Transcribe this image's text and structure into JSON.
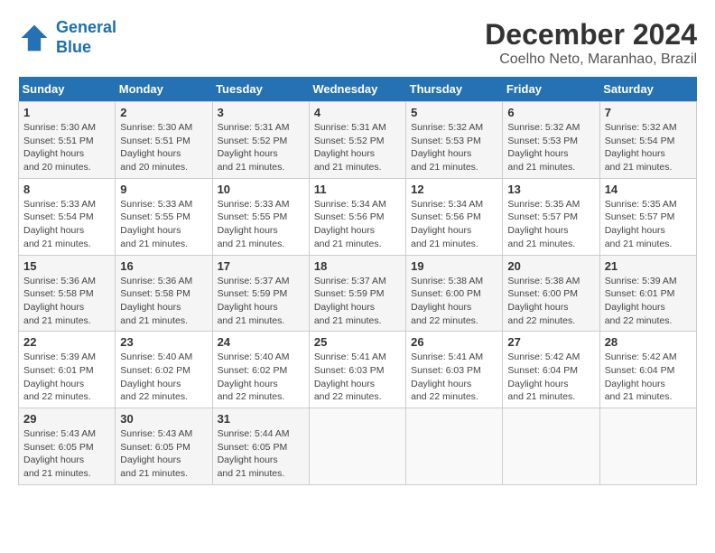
{
  "header": {
    "logo_line1": "General",
    "logo_line2": "Blue",
    "month_title": "December 2024",
    "subtitle": "Coelho Neto, Maranhao, Brazil"
  },
  "weekdays": [
    "Sunday",
    "Monday",
    "Tuesday",
    "Wednesday",
    "Thursday",
    "Friday",
    "Saturday"
  ],
  "weeks": [
    [
      {
        "day": "1",
        "sunrise": "5:30 AM",
        "sunset": "5:51 PM",
        "daylight": "12 hours and 20 minutes."
      },
      {
        "day": "2",
        "sunrise": "5:30 AM",
        "sunset": "5:51 PM",
        "daylight": "12 hours and 20 minutes."
      },
      {
        "day": "3",
        "sunrise": "5:31 AM",
        "sunset": "5:52 PM",
        "daylight": "12 hours and 21 minutes."
      },
      {
        "day": "4",
        "sunrise": "5:31 AM",
        "sunset": "5:52 PM",
        "daylight": "12 hours and 21 minutes."
      },
      {
        "day": "5",
        "sunrise": "5:32 AM",
        "sunset": "5:53 PM",
        "daylight": "12 hours and 21 minutes."
      },
      {
        "day": "6",
        "sunrise": "5:32 AM",
        "sunset": "5:53 PM",
        "daylight": "12 hours and 21 minutes."
      },
      {
        "day": "7",
        "sunrise": "5:32 AM",
        "sunset": "5:54 PM",
        "daylight": "12 hours and 21 minutes."
      }
    ],
    [
      {
        "day": "8",
        "sunrise": "5:33 AM",
        "sunset": "5:54 PM",
        "daylight": "12 hours and 21 minutes."
      },
      {
        "day": "9",
        "sunrise": "5:33 AM",
        "sunset": "5:55 PM",
        "daylight": "12 hours and 21 minutes."
      },
      {
        "day": "10",
        "sunrise": "5:33 AM",
        "sunset": "5:55 PM",
        "daylight": "12 hours and 21 minutes."
      },
      {
        "day": "11",
        "sunrise": "5:34 AM",
        "sunset": "5:56 PM",
        "daylight": "12 hours and 21 minutes."
      },
      {
        "day": "12",
        "sunrise": "5:34 AM",
        "sunset": "5:56 PM",
        "daylight": "12 hours and 21 minutes."
      },
      {
        "day": "13",
        "sunrise": "5:35 AM",
        "sunset": "5:57 PM",
        "daylight": "12 hours and 21 minutes."
      },
      {
        "day": "14",
        "sunrise": "5:35 AM",
        "sunset": "5:57 PM",
        "daylight": "12 hours and 21 minutes."
      }
    ],
    [
      {
        "day": "15",
        "sunrise": "5:36 AM",
        "sunset": "5:58 PM",
        "daylight": "12 hours and 21 minutes."
      },
      {
        "day": "16",
        "sunrise": "5:36 AM",
        "sunset": "5:58 PM",
        "daylight": "12 hours and 21 minutes."
      },
      {
        "day": "17",
        "sunrise": "5:37 AM",
        "sunset": "5:59 PM",
        "daylight": "12 hours and 21 minutes."
      },
      {
        "day": "18",
        "sunrise": "5:37 AM",
        "sunset": "5:59 PM",
        "daylight": "12 hours and 21 minutes."
      },
      {
        "day": "19",
        "sunrise": "5:38 AM",
        "sunset": "6:00 PM",
        "daylight": "12 hours and 22 minutes."
      },
      {
        "day": "20",
        "sunrise": "5:38 AM",
        "sunset": "6:00 PM",
        "daylight": "12 hours and 22 minutes."
      },
      {
        "day": "21",
        "sunrise": "5:39 AM",
        "sunset": "6:01 PM",
        "daylight": "12 hours and 22 minutes."
      }
    ],
    [
      {
        "day": "22",
        "sunrise": "5:39 AM",
        "sunset": "6:01 PM",
        "daylight": "12 hours and 22 minutes."
      },
      {
        "day": "23",
        "sunrise": "5:40 AM",
        "sunset": "6:02 PM",
        "daylight": "12 hours and 22 minutes."
      },
      {
        "day": "24",
        "sunrise": "5:40 AM",
        "sunset": "6:02 PM",
        "daylight": "12 hours and 22 minutes."
      },
      {
        "day": "25",
        "sunrise": "5:41 AM",
        "sunset": "6:03 PM",
        "daylight": "12 hours and 22 minutes."
      },
      {
        "day": "26",
        "sunrise": "5:41 AM",
        "sunset": "6:03 PM",
        "daylight": "12 hours and 22 minutes."
      },
      {
        "day": "27",
        "sunrise": "5:42 AM",
        "sunset": "6:04 PM",
        "daylight": "12 hours and 21 minutes."
      },
      {
        "day": "28",
        "sunrise": "5:42 AM",
        "sunset": "6:04 PM",
        "daylight": "12 hours and 21 minutes."
      }
    ],
    [
      {
        "day": "29",
        "sunrise": "5:43 AM",
        "sunset": "6:05 PM",
        "daylight": "12 hours and 21 minutes."
      },
      {
        "day": "30",
        "sunrise": "5:43 AM",
        "sunset": "6:05 PM",
        "daylight": "12 hours and 21 minutes."
      },
      {
        "day": "31",
        "sunrise": "5:44 AM",
        "sunset": "6:05 PM",
        "daylight": "12 hours and 21 minutes."
      },
      null,
      null,
      null,
      null
    ]
  ]
}
